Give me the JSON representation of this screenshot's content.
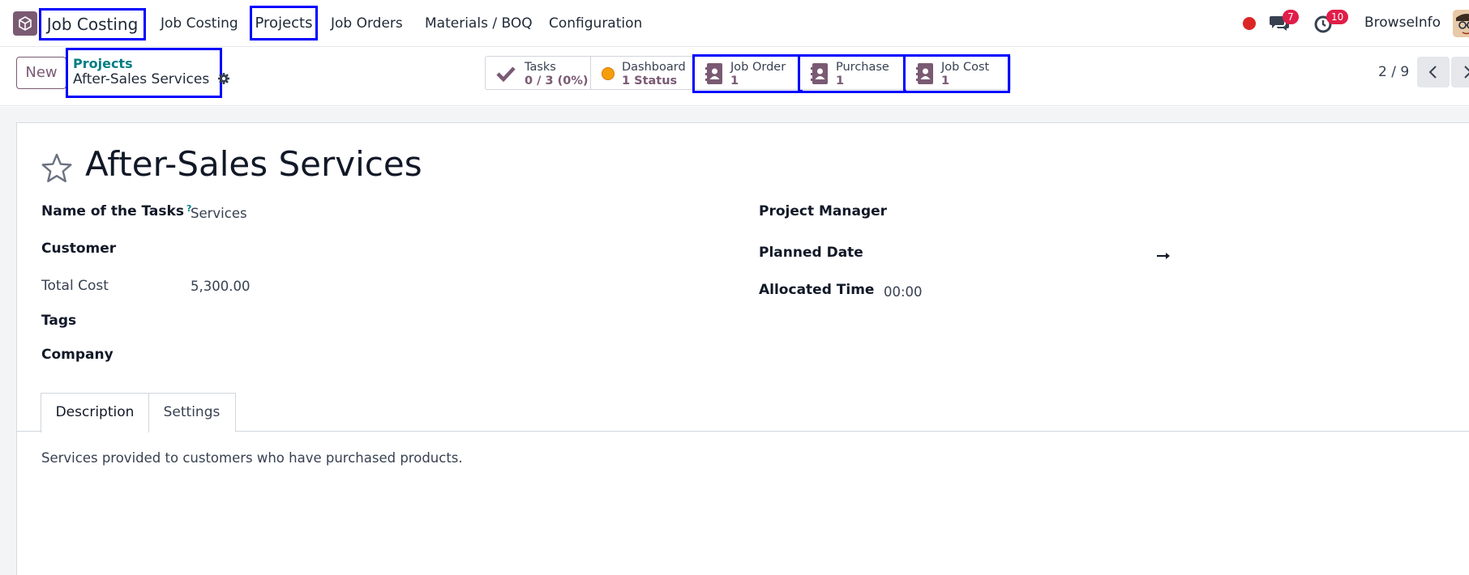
{
  "navbar": {
    "app_name": "Job Costing",
    "menu": [
      "Job Costing",
      "Projects",
      "Job Orders",
      "Materials / BOQ",
      "Configuration"
    ],
    "chat_count": "7",
    "activity_count": "10",
    "company": "BrowseInfo"
  },
  "control_panel": {
    "new_label": "New",
    "breadcrumb_parent": "Projects",
    "breadcrumb_current": "After-Sales Services",
    "pager": "2 / 9"
  },
  "smart_buttons": {
    "tasks": {
      "title": "Tasks",
      "value": "0 / 3 (0%)"
    },
    "dashboard": {
      "title": "Dashboard",
      "value": "1 Status"
    },
    "job_order": {
      "title": "Job Order",
      "value": "1"
    },
    "purchase": {
      "title": "Purchase",
      "value": "1"
    },
    "job_cost": {
      "title": "Job Cost",
      "value": "1"
    }
  },
  "form": {
    "title": "After-Sales Services",
    "left_fields": {
      "task_name_label": "Name of the Tasks",
      "task_name_tooltip": "?",
      "task_name_value": "Services",
      "customer_label": "Customer",
      "total_cost_label": "Total Cost",
      "total_cost_value": "5,300.00",
      "tags_label": "Tags",
      "company_label": "Company"
    },
    "right_fields": {
      "project_manager_label": "Project Manager",
      "planned_date_label": "Planned Date",
      "allocated_time_label": "Allocated Time",
      "allocated_time_value": "00:00"
    },
    "tabs": [
      "Description",
      "Settings"
    ],
    "description": "Services provided to customers who have purchased products."
  },
  "colors": {
    "brand": "#7a5a73",
    "link": "#017e84",
    "highlight": "#0000ff",
    "badge": "#e11d48",
    "status_dot": "#dc2626"
  }
}
